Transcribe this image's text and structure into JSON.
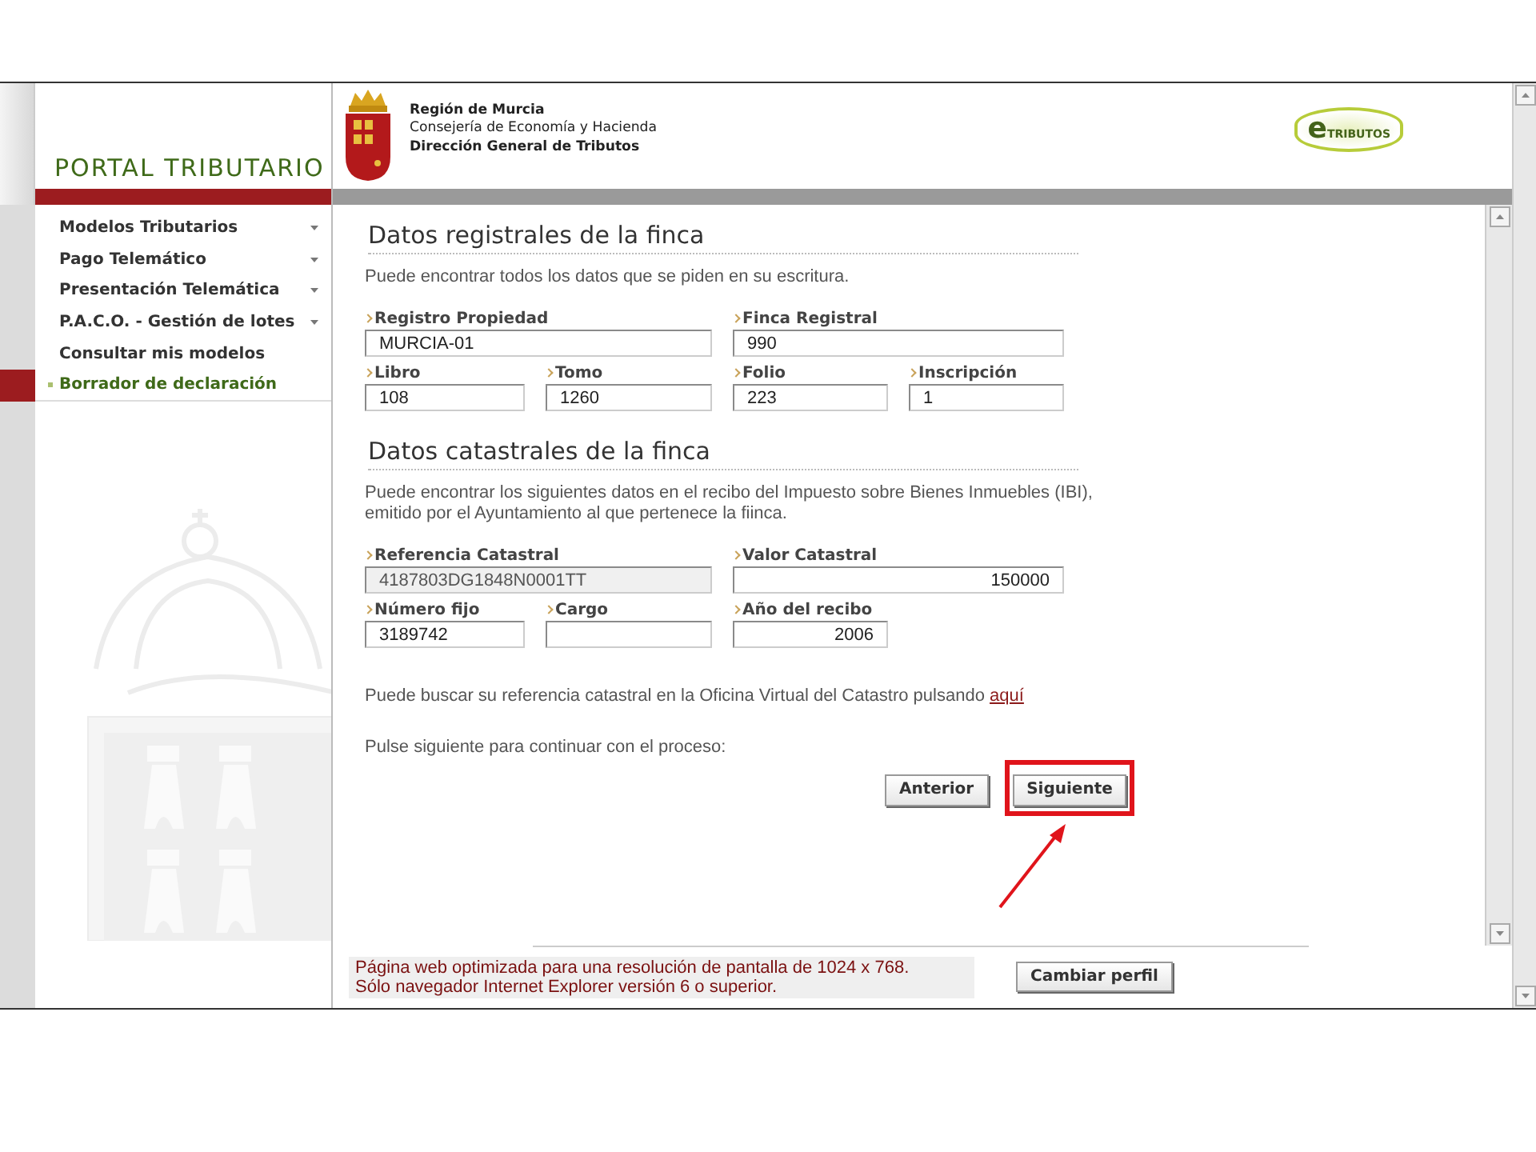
{
  "header": {
    "portal_title": "PORTAL TRIBUTARIO",
    "org_lines": [
      {
        "text": "Región de Murcia",
        "bold": true
      },
      {
        "text": "Consejería de Economía y Hacienda",
        "bold": false
      },
      {
        "text": "Dirección General de Tributos",
        "bold": true
      }
    ],
    "brand": {
      "mark": "e",
      "text": "TRIBUTOS"
    }
  },
  "sidebar": {
    "items": [
      {
        "label": "Modelos Tributarios",
        "has_submenu": true,
        "selected": false
      },
      {
        "label": "Pago Telemático",
        "has_submenu": true,
        "selected": false
      },
      {
        "label": "Presentación Telemática",
        "has_submenu": true,
        "selected": false
      },
      {
        "label": "P.A.C.O. - Gestión de lotes",
        "has_submenu": true,
        "selected": false
      },
      {
        "label": "Consultar mis modelos",
        "has_submenu": false,
        "selected": false
      },
      {
        "label": "Borrador de declaración",
        "has_submenu": false,
        "selected": true
      }
    ]
  },
  "sections": [
    {
      "title": "Datos registrales de la finca",
      "intro": "Puede encontrar todos los datos que se piden en su escritura.",
      "fields": [
        {
          "label": "Registro Propiedad",
          "value": "MURCIA-01",
          "kind": "text",
          "wide": true,
          "readonly": false
        },
        {
          "label": "Finca Registral",
          "value": "990",
          "kind": "text",
          "wide": true,
          "readonly": false
        },
        {
          "label": "Libro",
          "value": "108",
          "kind": "text",
          "wide": false,
          "readonly": false
        },
        {
          "label": "Tomo",
          "value": "1260",
          "kind": "text",
          "wide": false,
          "readonly": false
        },
        {
          "label": "Folio",
          "value": "223",
          "kind": "text",
          "wide": false,
          "readonly": false
        },
        {
          "label": "Inscripción",
          "value": "1",
          "kind": "text",
          "wide": false,
          "readonly": false
        }
      ]
    },
    {
      "title": "Datos catastrales de la finca",
      "intro": "Puede encontrar los siguientes datos en el recibo del Impuesto sobre Bienes Inmuebles (IBI), emitido por el Ayuntamiento al que pertenece la fiinca.",
      "fields": [
        {
          "label": "Referencia Catastral",
          "value": "4187803DG1848N0001TT",
          "kind": "text",
          "wide": true,
          "readonly": true
        },
        {
          "label": "Valor Catastral",
          "value": "150000",
          "kind": "number",
          "wide": true,
          "readonly": false
        },
        {
          "label": "Número fijo",
          "value": "3189742",
          "kind": "text",
          "wide": false,
          "readonly": false
        },
        {
          "label": "Cargo",
          "kind": "text",
          "wide": false,
          "readonly": false
        },
        {
          "label": "Año del recibo",
          "value": "2006",
          "kind": "number",
          "wide": false,
          "readonly": false
        }
      ]
    }
  ],
  "lookup": {
    "text": "Puede buscar su referencia catastral en la Oficina Virtual del Catastro pulsando",
    "link": "aquí"
  },
  "prompt": "Pulse siguiente para continuar con el proceso:",
  "buttons": [
    {
      "label": "Anterior",
      "highlighted": false
    },
    {
      "label": "Siguiente",
      "highlighted": true
    }
  ],
  "footer": {
    "notice": [
      "Página web optimizada para una resolución de pantalla de 1024 x 768.",
      "Sólo navegador Internet Explorer versión 6 o superior."
    ],
    "button": "Cambiar perfil"
  }
}
